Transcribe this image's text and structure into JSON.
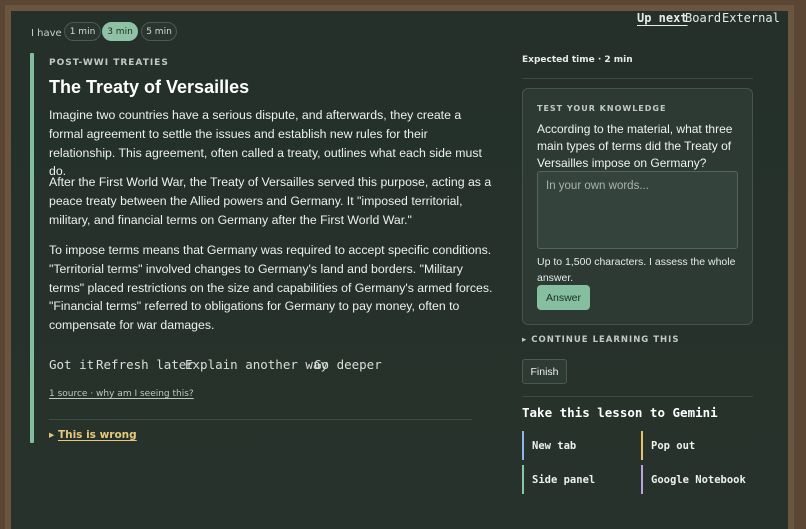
{
  "time_chooser": {
    "label": "I have",
    "options": [
      "1 min",
      "3 min",
      "5 min"
    ],
    "selected": "3 min"
  },
  "nav": {
    "items": [
      "Up next",
      "Board",
      "External"
    ],
    "active": "Up next"
  },
  "lesson": {
    "kicker": "POST-WWI TREATIES",
    "title": "The Treaty of Versailles",
    "paragraphs": [
      "Imagine two countries have a serious dispute, and afterwards, they create a formal agreement to settle the issues and establish new rules for their relationship. This agreement, often called a treaty, outlines what each side must do.",
      "After the First World War, the Treaty of Versailles served this purpose, acting as a peace treaty between the Allied powers and Germany. It \"imposed territorial, military, and financial terms on Germany after the First World War.\"",
      "To impose terms means that Germany was required to accept specific conditions. \"Territorial terms\" involved changes to Germany's land and borders. \"Military terms\" placed restrictions on the size and capabilities of Germany's armed forces. \"Financial terms\" referred to obligations for Germany to pay money, often to compensate for war damages."
    ],
    "actions": [
      "Got it",
      "Refresh later",
      "Explain another way",
      "Go deeper"
    ],
    "source_link": "1 source · why am I seeing this?",
    "report": {
      "arrow": "▸",
      "label": "This is wrong"
    },
    "accent_color": "#7fbf9e"
  },
  "sidebar": {
    "expected_time": "Expected time · 2 min",
    "quiz": {
      "kicker": "TEST YOUR KNOWLEDGE",
      "question": "According to the material, what three main types of terms did the Treaty of Versailles impose on Germany?",
      "placeholder": "In your own words...",
      "value": "",
      "hint": "Up to 1,500 characters. I assess the whole answer.",
      "submit_label": "Answer"
    },
    "continue": {
      "arrow": "▸",
      "label": "CONTINUE LEARNING THIS"
    },
    "finish_label": "Finish",
    "gemini": {
      "title": "Take this lesson to Gemini",
      "options": [
        {
          "label": "New tab",
          "color": "#8fb4e6"
        },
        {
          "label": "Pop out",
          "color": "#e6c36a"
        },
        {
          "label": "Side panel",
          "color": "#86c7a4"
        },
        {
          "label": "Google Notebook",
          "color": "#b9a2df"
        }
      ]
    }
  }
}
